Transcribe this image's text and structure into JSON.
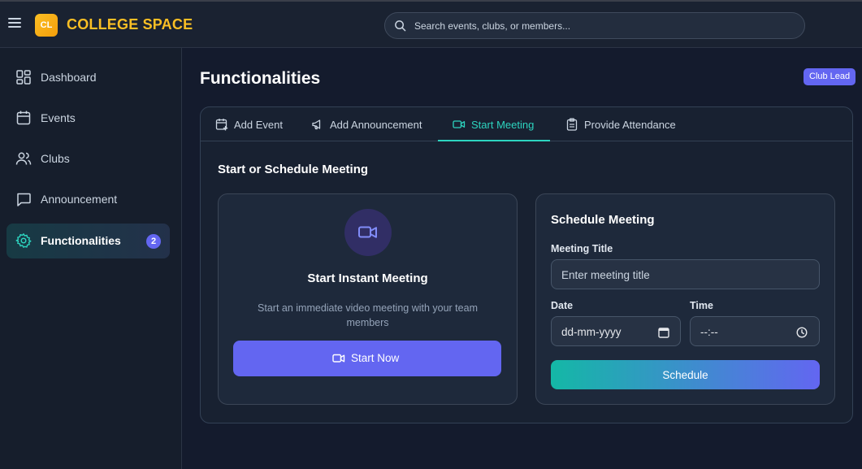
{
  "app": {
    "logo_initials": "CL",
    "name": "COLLEGE SPACE"
  },
  "search": {
    "placeholder": "Search events, clubs, or members..."
  },
  "sidebar": {
    "items": [
      {
        "label": "Dashboard",
        "icon": "dashboard-icon"
      },
      {
        "label": "Events",
        "icon": "calendar-icon"
      },
      {
        "label": "Clubs",
        "icon": "users-icon"
      },
      {
        "label": "Announcement",
        "icon": "message-icon"
      },
      {
        "label": "Functionalities",
        "icon": "gear-icon",
        "active": true,
        "badge": "2"
      }
    ]
  },
  "page": {
    "title": "Functionalities",
    "role_badge": "Club Lead"
  },
  "tabs": [
    {
      "label": "Add Event",
      "icon": "calendar-plus-icon"
    },
    {
      "label": "Add Announcement",
      "icon": "megaphone-icon"
    },
    {
      "label": "Start Meeting",
      "icon": "video-icon",
      "active": true
    },
    {
      "label": "Provide Attendance",
      "icon": "clipboard-icon"
    }
  ],
  "meeting": {
    "section_title": "Start or Schedule Meeting",
    "instant": {
      "title": "Start Instant Meeting",
      "description": "Start an immediate video meeting with your team members",
      "button": "Start Now"
    },
    "schedule": {
      "title": "Schedule Meeting",
      "meeting_title_label": "Meeting Title",
      "meeting_title_placeholder": "Enter meeting title",
      "date_label": "Date",
      "date_value": "dd-mm-yyyy",
      "time_label": "Time",
      "time_value": "--:--",
      "button": "Schedule"
    }
  },
  "colors": {
    "accent": "#6366f1",
    "teal": "#2dd4bf",
    "brand": "#fbbf24"
  }
}
